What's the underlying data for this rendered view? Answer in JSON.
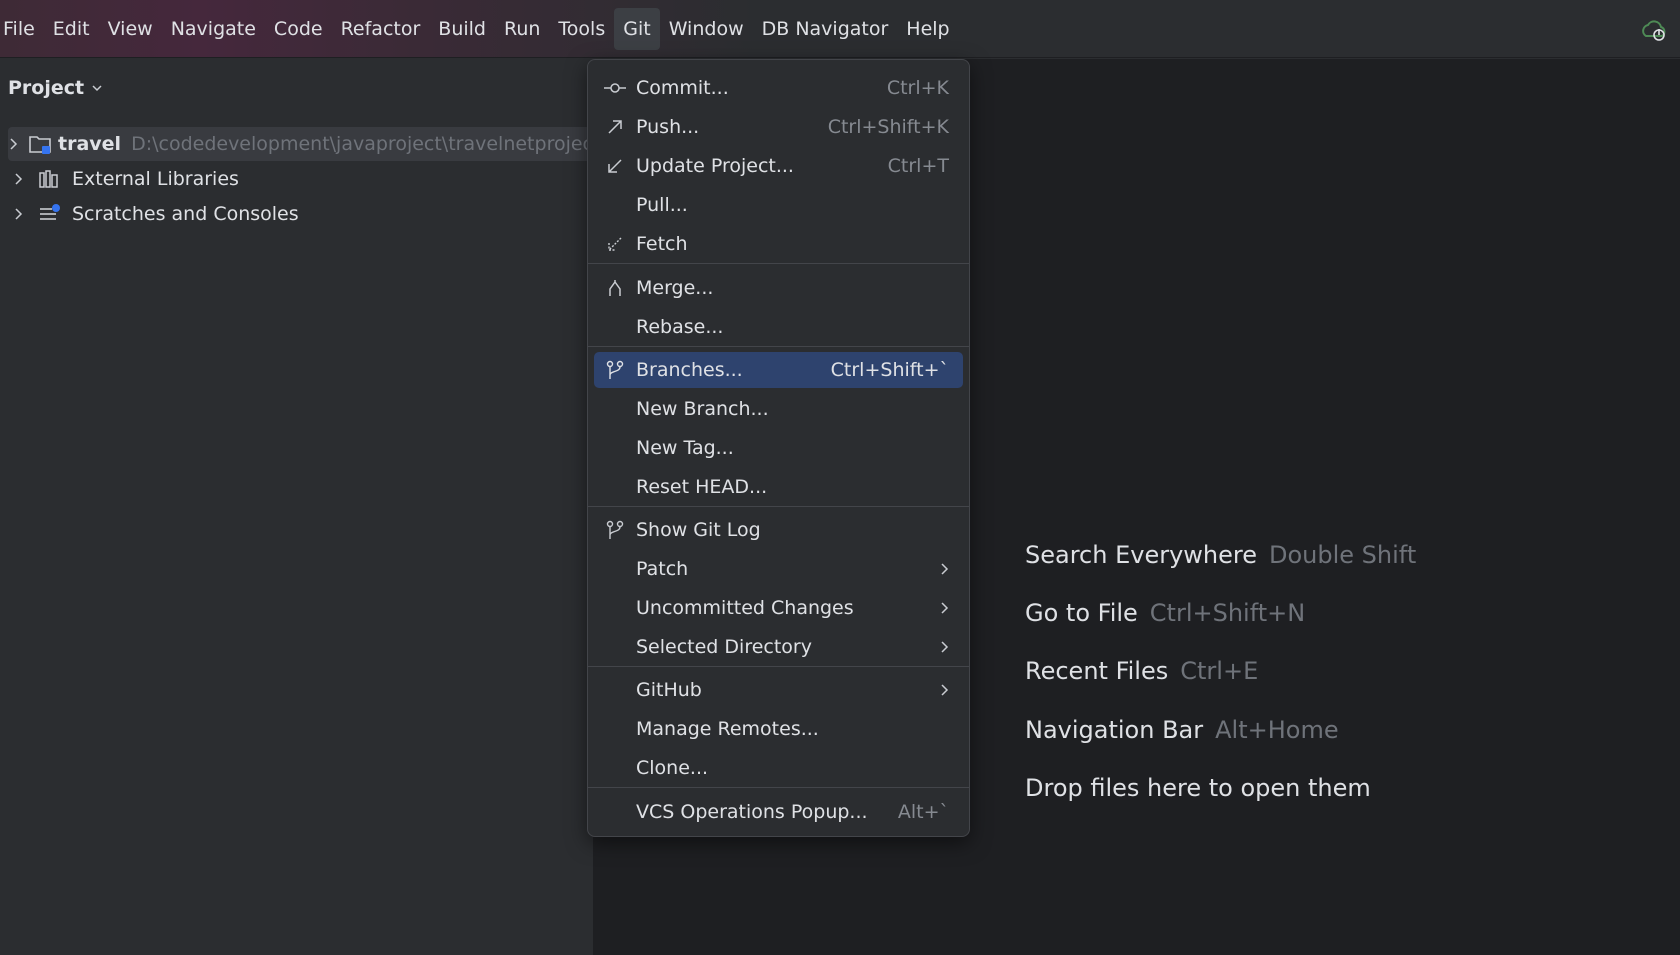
{
  "menubar": {
    "items": [
      "File",
      "Edit",
      "View",
      "Navigate",
      "Code",
      "Refactor",
      "Build",
      "Run",
      "Tools",
      "Git",
      "Window",
      "DB Navigator",
      "Help"
    ],
    "active": "Git"
  },
  "project": {
    "title": "Project",
    "tree": [
      {
        "label": "travel",
        "path": "D:\\codedevelopment\\javaproject\\travelnetproject\\tra"
      },
      {
        "label": "External Libraries"
      },
      {
        "label": "Scratches and Consoles"
      }
    ]
  },
  "git_menu": {
    "items": [
      {
        "label": "Commit...",
        "shortcut": "Ctrl+K",
        "icon": "commit-icon"
      },
      {
        "label": "Push...",
        "shortcut": "Ctrl+Shift+K",
        "icon": "push-arrow-icon"
      },
      {
        "label": "Update Project...",
        "shortcut": "Ctrl+T",
        "icon": "update-arrow-icon"
      },
      {
        "label": "Pull...",
        "shortcut": ""
      },
      {
        "label": "Fetch",
        "shortcut": "",
        "icon": "fetch-icon"
      },
      {
        "label": "Merge...",
        "shortcut": "",
        "icon": "merge-icon"
      },
      {
        "label": "Rebase...",
        "shortcut": ""
      },
      {
        "label": "Branches...",
        "shortcut": "Ctrl+Shift+`",
        "icon": "branch-icon",
        "highlighted": true
      },
      {
        "label": "New Branch...",
        "shortcut": ""
      },
      {
        "label": "New Tag...",
        "shortcut": ""
      },
      {
        "label": "Reset HEAD...",
        "shortcut": ""
      },
      {
        "label": "Show Git Log",
        "shortcut": "",
        "icon": "git-log-icon"
      },
      {
        "label": "Patch",
        "submenu": true
      },
      {
        "label": "Uncommitted Changes",
        "submenu": true
      },
      {
        "label": "Selected Directory",
        "submenu": true
      },
      {
        "label": "GitHub",
        "submenu": true
      },
      {
        "label": "Manage Remotes...",
        "shortcut": ""
      },
      {
        "label": "Clone...",
        "shortcut": ""
      },
      {
        "label": "VCS Operations Popup...",
        "shortcut": "Alt+`"
      }
    ]
  },
  "editor_hints": [
    {
      "label": "Search Everywhere",
      "shortcut": "Double Shift"
    },
    {
      "label": "Go to File",
      "shortcut": "Ctrl+Shift+N"
    },
    {
      "label": "Recent Files",
      "shortcut": "Ctrl+E"
    },
    {
      "label": "Navigation Bar",
      "shortcut": "Alt+Home"
    },
    {
      "label": "Drop files here to open them",
      "shortcut": ""
    }
  ],
  "colors": {
    "background": "#2b2d30",
    "editor": "#1e1f22",
    "highlight": "#2e436e",
    "muted_text": "#6f737a"
  }
}
